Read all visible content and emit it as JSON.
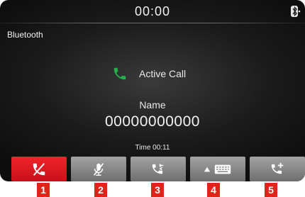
{
  "header": {
    "clock": "00:00",
    "source_title": "Bluetooth"
  },
  "call": {
    "status": "Active Call",
    "contact_name": "Name",
    "phone_number": "00000000000",
    "time_label": "Time 00:11"
  },
  "buttons": [
    {
      "icon": "end-call-icon",
      "color": "#e8141d",
      "callout": "1"
    },
    {
      "icon": "mic-mute-icon",
      "color": "#8c8c8c",
      "callout": "2"
    },
    {
      "icon": "switch-to-phone-icon",
      "color": "#8c8c8c",
      "callout": "3"
    },
    {
      "icon": "keypad-icon",
      "color": "#8c8c8c",
      "callout": "4"
    },
    {
      "icon": "add-call-icon",
      "color": "#8c8c8c",
      "callout": "5"
    }
  ],
  "colors": {
    "active_phone": "#22b04a",
    "end_call": "#e8141d",
    "callout": "#e2231a"
  }
}
